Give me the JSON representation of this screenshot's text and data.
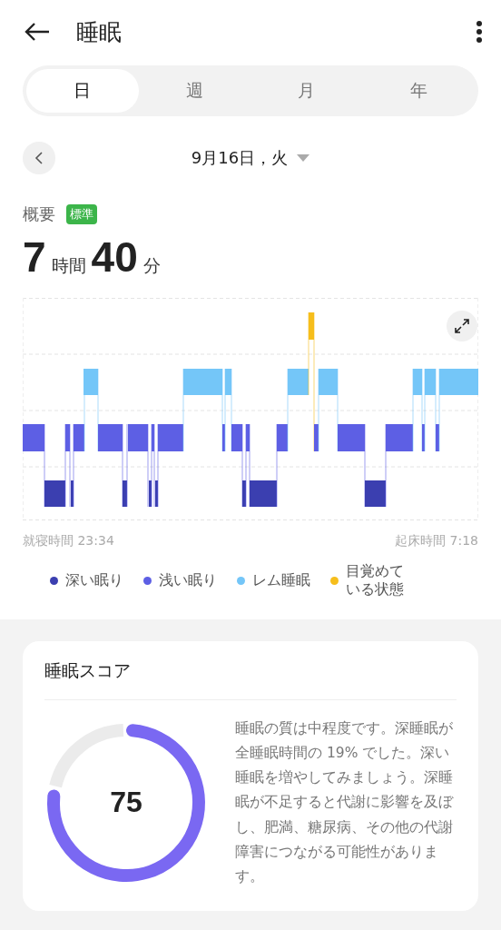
{
  "header": {
    "title": "睡眠"
  },
  "tabs": [
    {
      "label": "日",
      "selected": true
    },
    {
      "label": "週",
      "selected": false
    },
    {
      "label": "月",
      "selected": false
    },
    {
      "label": "年",
      "selected": false
    }
  ],
  "date": {
    "label": "9月16日，火"
  },
  "summary": {
    "title": "概要",
    "badge": "標準",
    "hours": "7",
    "hours_unit": "時間",
    "minutes": "40",
    "minutes_unit": "分"
  },
  "chart": {
    "start_label": "就寝時間 23:34",
    "end_label": "起床時間 7:18"
  },
  "legend": [
    {
      "label": "深い眠り",
      "color": "#3b3fb0"
    },
    {
      "label": "浅い眠り",
      "color": "#5d5fe4"
    },
    {
      "label": "レム睡眠",
      "color": "#74c6f8"
    },
    {
      "label": "目覚めている状態",
      "color": "#f6be1c"
    }
  ],
  "score_card": {
    "title": "睡眠スコア",
    "score": "75",
    "level": 0.75,
    "description": "睡眠の質は中程度です。深睡眠が全睡眠時間の 19% でした。深い睡眠を増やしてみましょう。深睡眠が不足すると代謝に影響を及ぼし、肥満、糖尿病、その他の代謝障害につながる可能性があります。"
  }
}
